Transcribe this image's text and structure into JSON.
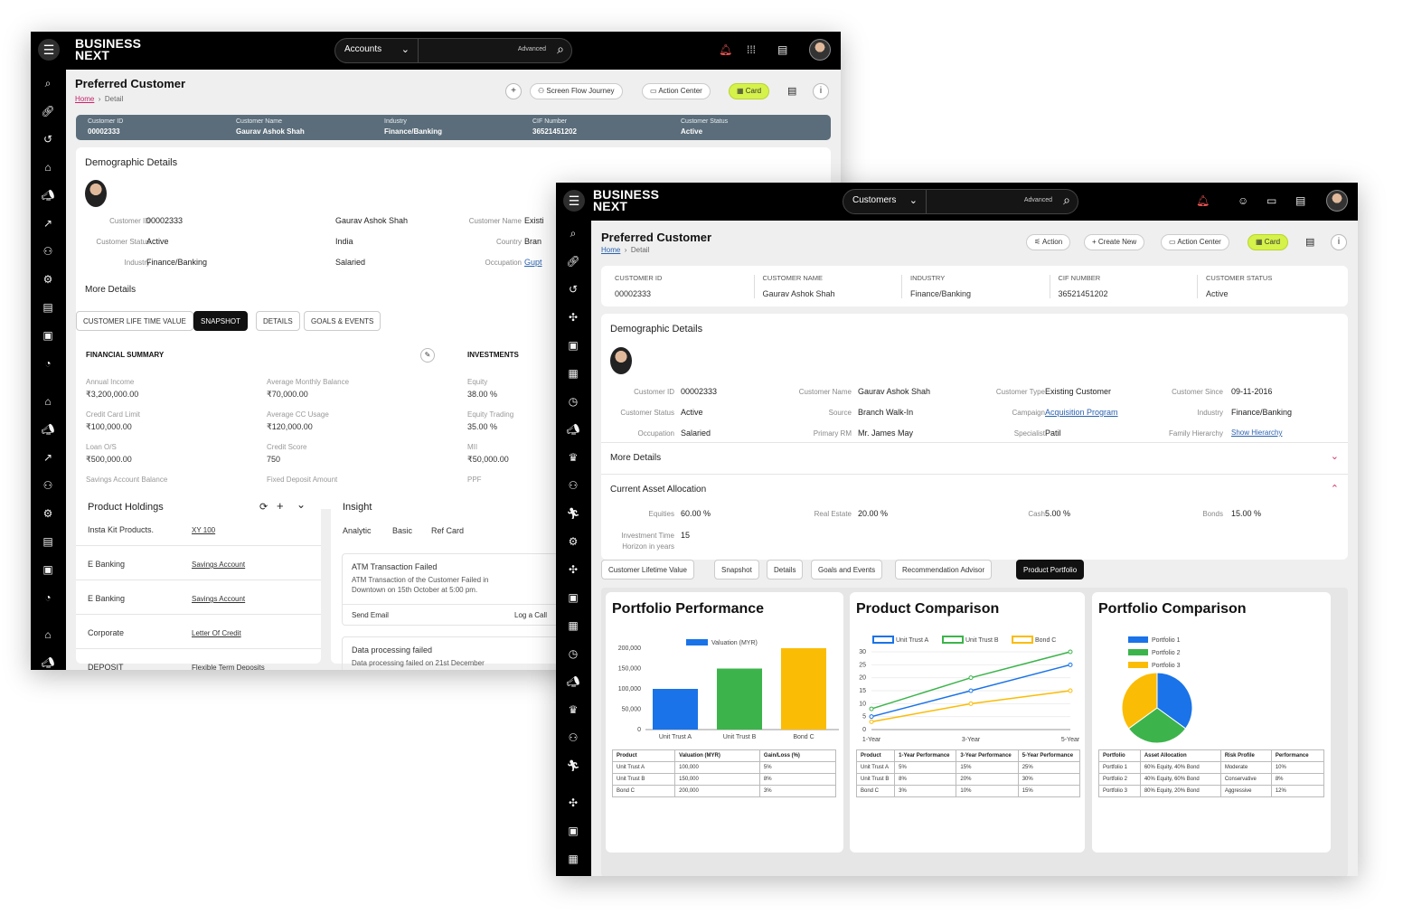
{
  "brand": {
    "line1": "BUSINESS",
    "line2": "NEXT"
  },
  "search": {
    "advanced": "Advanced"
  },
  "w1": {
    "search_sel": "Accounts",
    "title": "Preferred Customer",
    "crumb_home": "Home",
    "crumb_cur": "Detail",
    "buttons": {
      "screen_flow": "Screen Flow Journey",
      "action_center": "Action Center",
      "card": "Card"
    },
    "strip": [
      {
        "l": "Customer ID",
        "v": "00002333"
      },
      {
        "l": "Customer Name",
        "v": "Gaurav Ashok Shah"
      },
      {
        "l": "Industry",
        "v": "Finance/Banking"
      },
      {
        "l": "CIF Number",
        "v": "36521451202"
      },
      {
        "l": "Customer Status",
        "v": "Active"
      }
    ],
    "demo_title": "Demographic Details",
    "demo": [
      {
        "l": "Customer ID",
        "v": "00002333"
      },
      {
        "l": "Customer Name",
        "v": "Gaurav Ashok Shah"
      },
      {
        "l": "Customer Type",
        "v": "Existi"
      },
      {
        "l": "Customer Status",
        "v": "Active"
      },
      {
        "l": "Country",
        "v": "India"
      },
      {
        "l": "Source",
        "v": "Bran"
      },
      {
        "l": "Industry",
        "v": "Finance/Banking"
      },
      {
        "l": "Occupation",
        "v": "Salaried"
      },
      {
        "l": "Primary RM",
        "v": "Gupt"
      }
    ],
    "more_details": "More Details",
    "tabs": [
      "CUSTOMER LIFE TIME VALUE",
      "SNAPSHOT",
      "DETAILS",
      "GOALS & EVENTS"
    ],
    "fin_title": "FINANCIAL SUMMARY",
    "fin": [
      {
        "l": "Annual Income",
        "v": "₹3,200,000.00"
      },
      {
        "l": "Average Monthly Balance",
        "v": "₹70,000.00"
      },
      {
        "l": "Credit Card Limit",
        "v": "₹100,000.00"
      },
      {
        "l": "Average CC Usage",
        "v": "₹120,000.00"
      },
      {
        "l": "Loan O/S",
        "v": "₹500,000.00"
      },
      {
        "l": "Credit Score",
        "v": "750"
      },
      {
        "l": "Savings Account Balance",
        "v": ""
      },
      {
        "l": "Fixed Deposit Amount",
        "v": ""
      }
    ],
    "inv_title": "INVESTMENTS",
    "inv": [
      {
        "l": "Equity",
        "v": "38.00 %"
      },
      {
        "l": "Equity Trading",
        "v": "35.00 %"
      },
      {
        "l": "MII",
        "v": "₹50,000.00"
      },
      {
        "l": "PPF",
        "v": ""
      }
    ],
    "ph_title": "Product Holdings",
    "ph": [
      {
        "n": "Insta Kit Products.",
        "v": "XY 100"
      },
      {
        "n": "E Banking",
        "v": "Savings Account"
      },
      {
        "n": "E Banking",
        "v": "Savings Account"
      },
      {
        "n": "Corporate",
        "v": "Letter Of Credit"
      },
      {
        "n": "DEPOSIT",
        "v": "Flexible Term Deposits"
      }
    ],
    "insight_title": "Insight",
    "insight_tabs": [
      "Analytic",
      "Basic",
      "Ref Card"
    ],
    "ins1": {
      "title": "ATM Transaction Failed",
      "body1": "ATM Transaction of the Customer Failed in",
      "body2": "Downtown on 15th October at 5:00 pm.",
      "a1": "Send Email",
      "a2": "Log a Call"
    },
    "ins2": {
      "title": "Data processing failed",
      "body1": "Data processing failed on 21st December"
    }
  },
  "w2": {
    "search_sel": "Customers",
    "title": "Preferred Customer",
    "crumb_home": "Home",
    "crumb_cur": "Detail",
    "buttons": {
      "action": "Action",
      "create_new": "Create New",
      "action_center": "Action Center",
      "card": "Card"
    },
    "strip": [
      {
        "l": "CUSTOMER ID",
        "v": "00002333"
      },
      {
        "l": "CUSTOMER NAME",
        "v": "Gaurav Ashok Shah"
      },
      {
        "l": "INDUSTRY",
        "v": "Finance/Banking"
      },
      {
        "l": "CIF NUMBER",
        "v": "36521451202"
      },
      {
        "l": "CUSTOMER STATUS",
        "v": "Active"
      }
    ],
    "demo_title": "Demographic Details",
    "demo": [
      {
        "l": "Customer ID",
        "v": "00002333"
      },
      {
        "l": "Customer Name",
        "v": "Gaurav Ashok Shah"
      },
      {
        "l": "Customer Type",
        "v": "Existing Customer"
      },
      {
        "l": "Customer Since",
        "v": "09-11-2016"
      },
      {
        "l": "Customer Status",
        "v": "Active"
      },
      {
        "l": "Source",
        "v": "Branch Walk-In"
      },
      {
        "l": "Campaign",
        "v": "Acquisition Program"
      },
      {
        "l": "Industry",
        "v": "Finance/Banking"
      },
      {
        "l": "Occupation",
        "v": "Salaried"
      },
      {
        "l": "Primary RM",
        "v": "Mr. James May"
      },
      {
        "l": "Specialist",
        "v": "Patil"
      },
      {
        "l": "Family Hierarchy",
        "v": "Show Hierarchy"
      }
    ],
    "more_details": "More Details",
    "asset_title": "Current Asset Allocation",
    "asset": [
      {
        "l": "Equities",
        "v": "60.00 %"
      },
      {
        "l": "Real Estate",
        "v": "20.00 %"
      },
      {
        "l": "Cash",
        "v": "5.00 %"
      },
      {
        "l": "Bonds",
        "v": "15.00 %"
      }
    ],
    "horizon": {
      "l1": "Investment Time",
      "l2": "Horizon in years",
      "v": "15"
    },
    "tabs": [
      "Customer Lifetime Value",
      "Snapshot",
      "Details",
      "Goals and Events",
      "Recommendation Advisor",
      "Product Portfolio"
    ],
    "card1": {
      "title": "Portfolio Performance",
      "headers": [
        "Product",
        "Valuation (MYR)",
        "Gain/Loss (%)"
      ],
      "rows": [
        [
          "Unit Trust A",
          "100,000",
          "5%"
        ],
        [
          "Unit Trust B",
          "150,000",
          "8%"
        ],
        [
          "Bond C",
          "200,000",
          "3%"
        ]
      ]
    },
    "card2": {
      "title": "Product Comparison",
      "headers": [
        "Product",
        "1-Year Performance",
        "3-Year Performance",
        "5-Year Performance"
      ],
      "rows": [
        [
          "Unit Trust A",
          "5%",
          "15%",
          "25%"
        ],
        [
          "Unit Trust B",
          "8%",
          "20%",
          "30%"
        ],
        [
          "Bond C",
          "3%",
          "10%",
          "15%"
        ]
      ]
    },
    "card3": {
      "title": "Portfolio Comparison",
      "headers": [
        "Portfolio",
        "Asset Allocation",
        "Risk Profile",
        "Performance"
      ],
      "rows": [
        [
          "Portfolio 1",
          "60% Equity, 40% Bond",
          "Moderate",
          "10%"
        ],
        [
          "Portfolio 2",
          "40% Equity, 60% Bond",
          "Conservative",
          "8%"
        ],
        [
          "Portfolio 3",
          "80% Equity, 20% Bond",
          "Aggressive",
          "12%"
        ]
      ]
    }
  },
  "colors": {
    "blue": "#1a73e8",
    "green": "#3cb44b",
    "yellow": "#fbbc05",
    "accent": "#d5f24b",
    "strip_bg": "#5b6d7a"
  },
  "chart_data": [
    {
      "type": "bar",
      "title": "Portfolio Performance",
      "categories": [
        "Unit Trust A",
        "Unit Trust B",
        "Bond C"
      ],
      "series": [
        {
          "name": "Valuation (MYR)",
          "values": [
            100000,
            150000,
            200000
          ]
        }
      ],
      "ylim": [
        0,
        200000
      ],
      "yticks": [
        "0",
        "50,000",
        "100,000",
        "150,000",
        "200,000"
      ],
      "legend": "top"
    },
    {
      "type": "line",
      "title": "Product Comparison",
      "x": [
        "1-Year",
        "3-Year",
        "5-Year"
      ],
      "series": [
        {
          "name": "Unit Trust A",
          "values": [
            5,
            15,
            25
          ]
        },
        {
          "name": "Unit Trust B",
          "values": [
            8,
            20,
            30
          ]
        },
        {
          "name": "Bond C",
          "values": [
            3,
            10,
            15
          ]
        }
      ],
      "ylim": [
        0,
        30
      ],
      "yticks": [
        "0",
        "5",
        "10",
        "15",
        "20",
        "25",
        "30"
      ],
      "legend": "top"
    },
    {
      "type": "pie",
      "title": "Portfolio Comparison",
      "series": [
        {
          "name": "Portfolio 1",
          "value": 35
        },
        {
          "name": "Portfolio 2",
          "value": 30
        },
        {
          "name": "Portfolio 3",
          "value": 35
        }
      ],
      "legend": "top-left"
    }
  ]
}
